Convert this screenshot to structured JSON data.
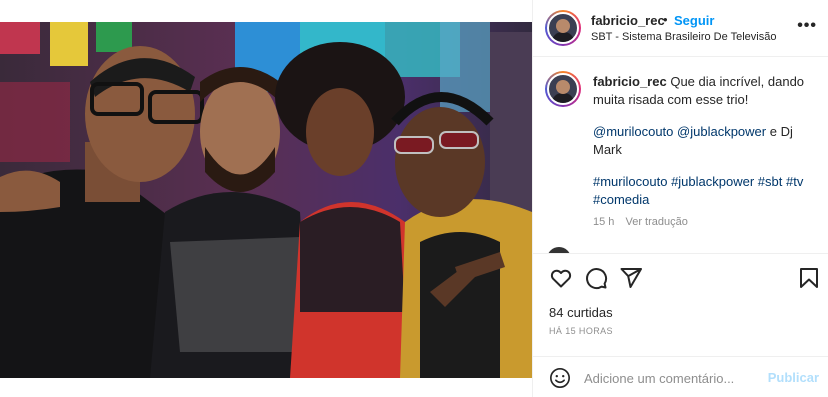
{
  "post": {
    "username": "fabricio_rec",
    "separator": "•",
    "follow_label": "Seguir",
    "location": "SBT - Sistema Brasileiro De Televisão",
    "more_icon": "more-horizontal-icon",
    "more_label": "•••"
  },
  "caption": {
    "username": "fabricio_rec",
    "text": "Que dia incrível, dando muita risada com esse trio!",
    "mention_1": "@murilocouto",
    "mention_2": "@jublackpower",
    "mention_joiner": "e Dj Mark",
    "hashtags": [
      "#murilocouto",
      "#jublackpower",
      "#sbt",
      "#tv",
      "#comedia"
    ],
    "time": "15 h",
    "translation_label": "Ver tradução"
  },
  "actions": {
    "like_icon": "heart-icon",
    "comment_icon": "comment-bubble-icon",
    "share_icon": "paper-plane-icon",
    "save_icon": "bookmark-icon"
  },
  "likes_label": "84 curtidas",
  "timestamp_label": "HÁ 15 HORAS",
  "comment_box": {
    "emoji_icon": "smiley-icon",
    "placeholder": "Adicione um comentário...",
    "post_label": "Publicar"
  },
  "colors": {
    "link_blue": "#0095f6",
    "hashtag_blue": "#00376b",
    "muted_gray": "#8e8e8e",
    "publish_disabled": "#b2dffc"
  }
}
